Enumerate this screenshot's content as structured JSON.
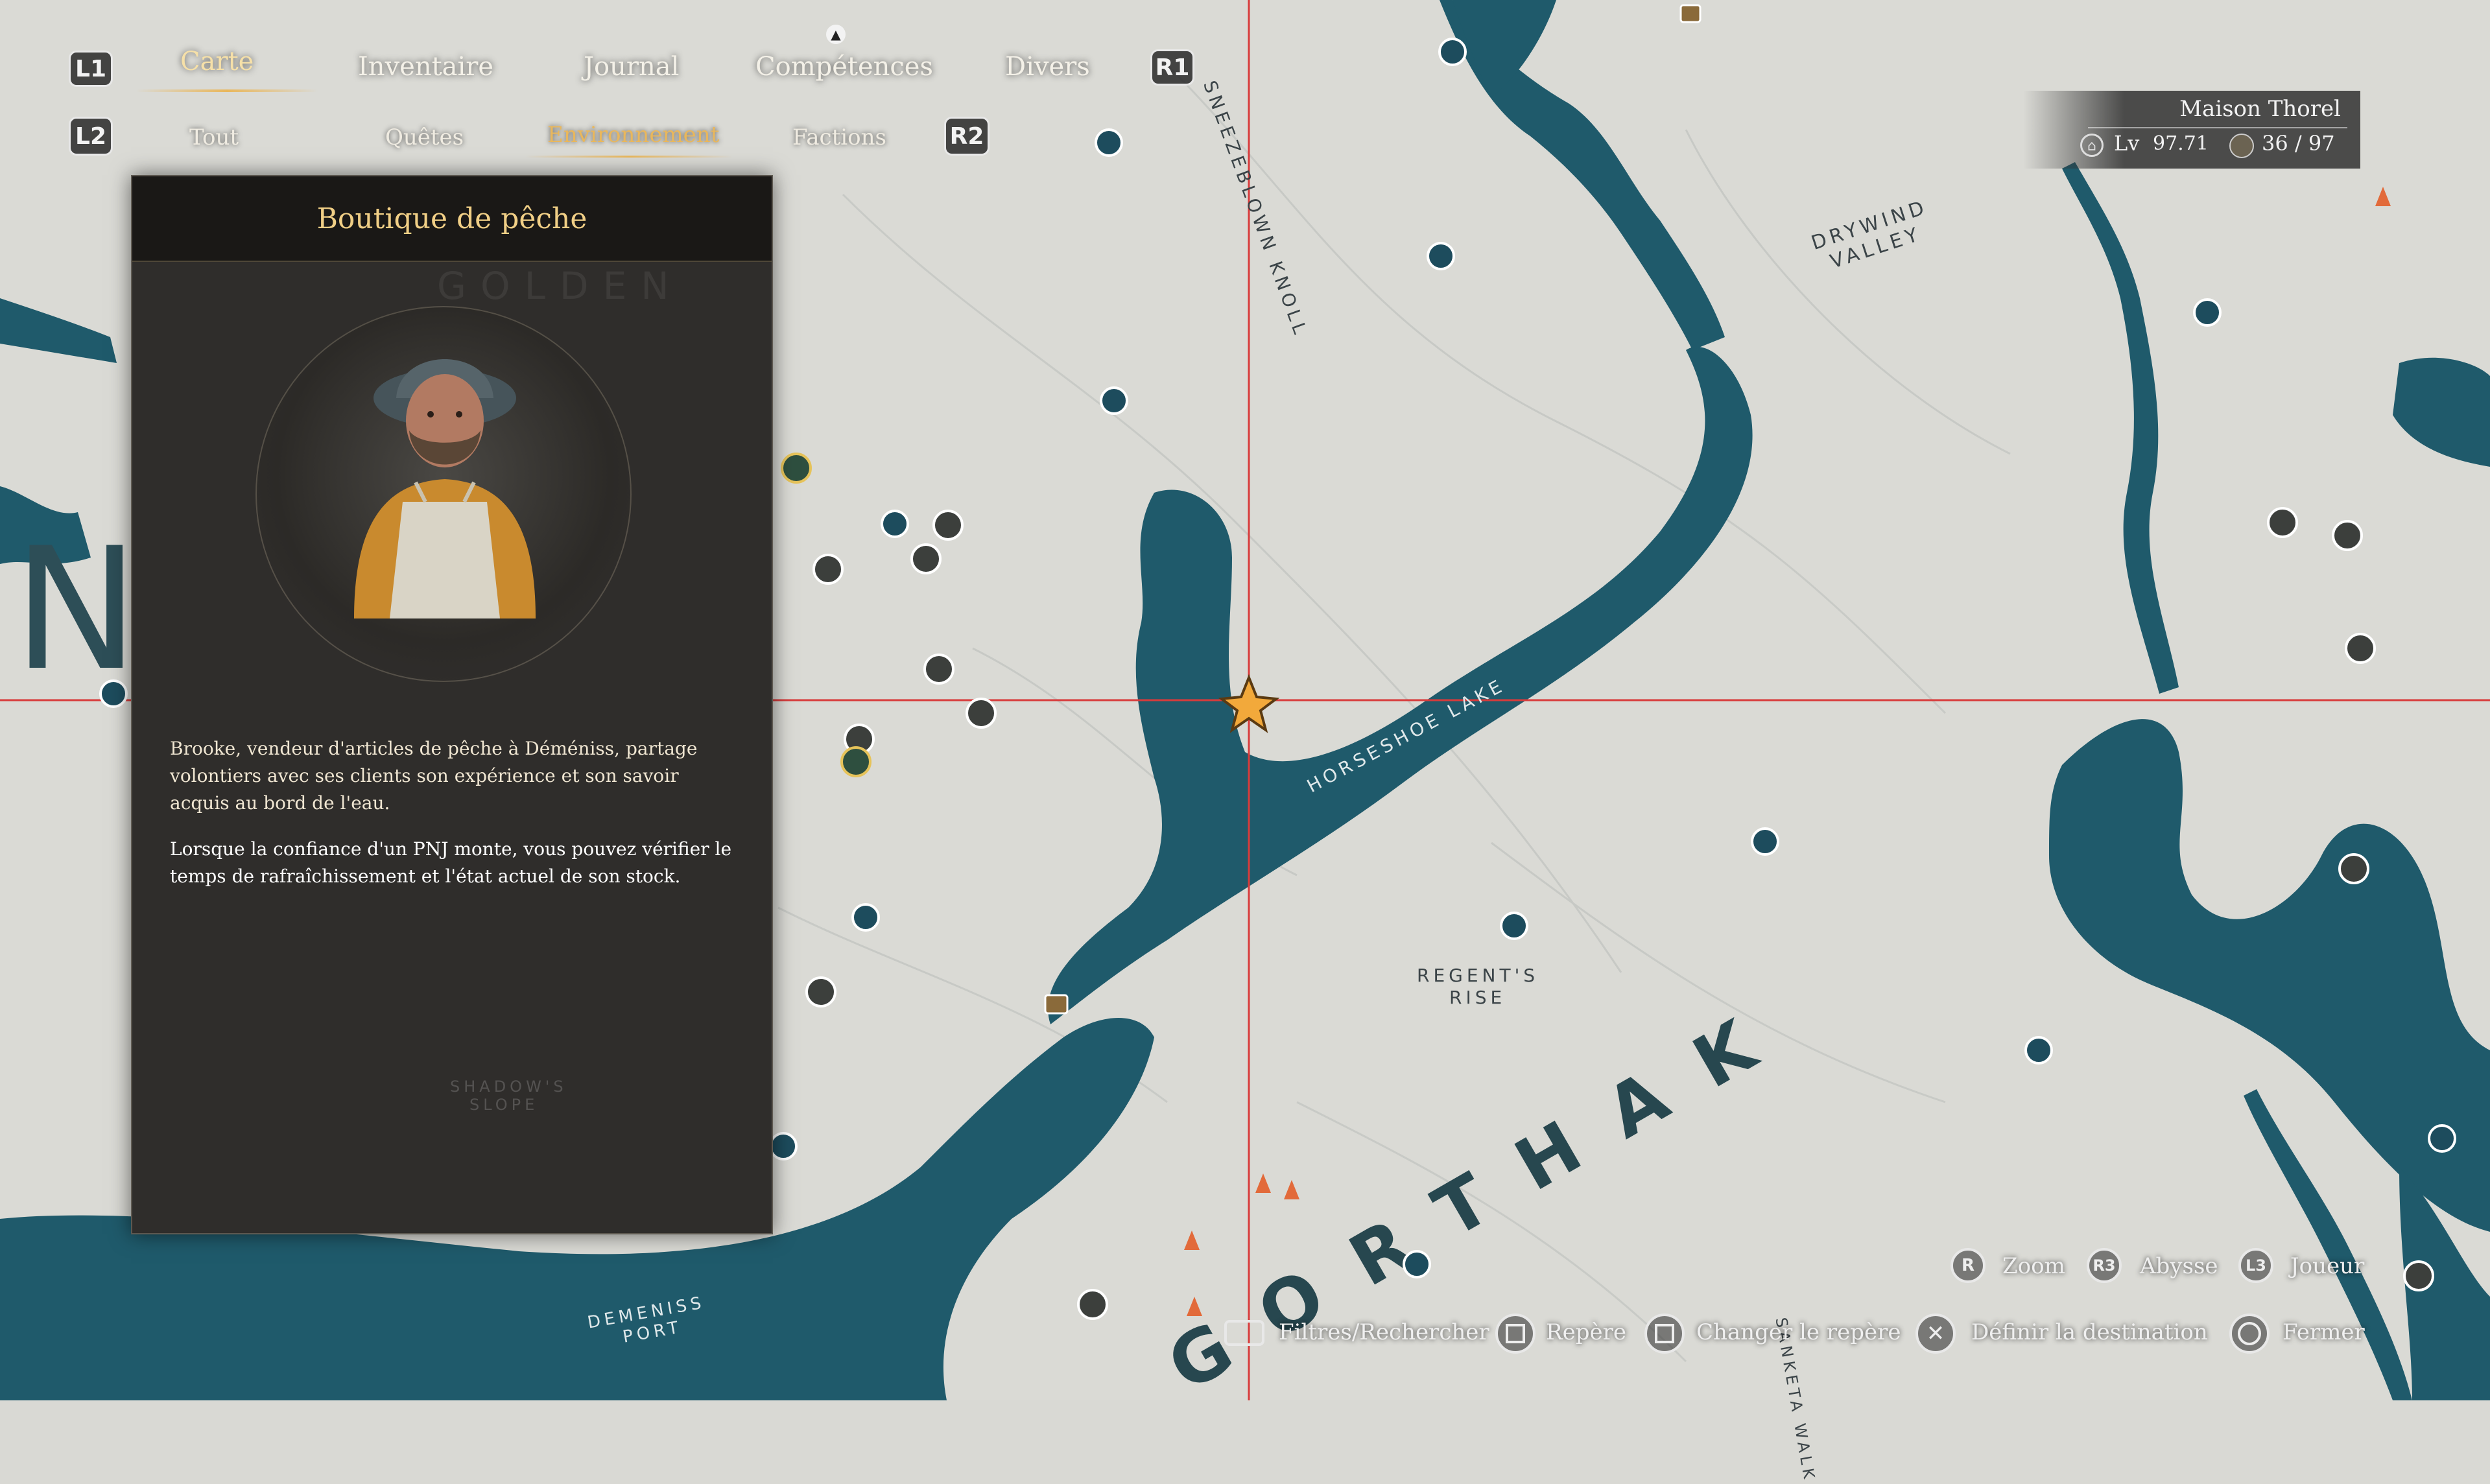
{
  "nav": {
    "l1": "L1",
    "r1": "R1",
    "l2": "L2",
    "r2": "R2",
    "tabs": [
      {
        "label": "Carte",
        "active": true
      },
      {
        "label": "Inventaire",
        "active": false
      },
      {
        "label": "Journal",
        "active": false
      },
      {
        "label": "Compétences",
        "active": false
      },
      {
        "label": "Divers",
        "active": false
      }
    ],
    "subtabs": [
      {
        "label": "Tout",
        "active": false
      },
      {
        "label": "Quêtes",
        "active": false
      },
      {
        "label": "Environnement",
        "active": true
      },
      {
        "label": "Factions",
        "active": false
      }
    ]
  },
  "player": {
    "location": "Maison Thorel",
    "level_label": "Lv",
    "level": "97.71",
    "resource": "36 / 97"
  },
  "panel": {
    "title": "Boutique de pêche",
    "description1": "Brooke, vendeur d'articles de pêche à Déméniss, partage volontiers avec ses clients son expérience et son savoir acquis au bord de l'eau.",
    "description2": "Lorsque la confiance d'un PNJ monte, vous pouvez vérifier le temps de rafraîchissement et l'état actuel de son stock.",
    "portrait_icon": "fisherman-portrait"
  },
  "map_labels": {
    "knoll": "SNEEZEBLOWN KNOLL",
    "drywind1": "DRYWIND",
    "drywind2": "VALLEY",
    "horseshoe": "HORSESHOE LAKE",
    "regent1": "REGENT'S",
    "regent2": "RISE",
    "gorthak": "GORTHAK",
    "demeniss1": "DEMENISS",
    "demeniss2": "PORT",
    "shadow1": "SHADOW'S",
    "shadow2": "SLOPE",
    "golden": "GOLDEN",
    "sanketa": "SANKETA WALK"
  },
  "controls": {
    "zoom_key": "R",
    "zoom": "Zoom",
    "abyss_key": "R3",
    "abyss": "Abysse",
    "player_key": "L3",
    "player": "Joueur",
    "filters": "Filtres/Rechercher",
    "mark": "Repère",
    "change_mark": "Changer le repère",
    "destination": "Définir la destination",
    "close": "Fermer"
  },
  "colors": {
    "water": "#1f5a6b",
    "land": "#d9d9d4",
    "crosshair": "#d83b3b",
    "accent": "#e9b75c",
    "panel": "#2f2d2b"
  }
}
